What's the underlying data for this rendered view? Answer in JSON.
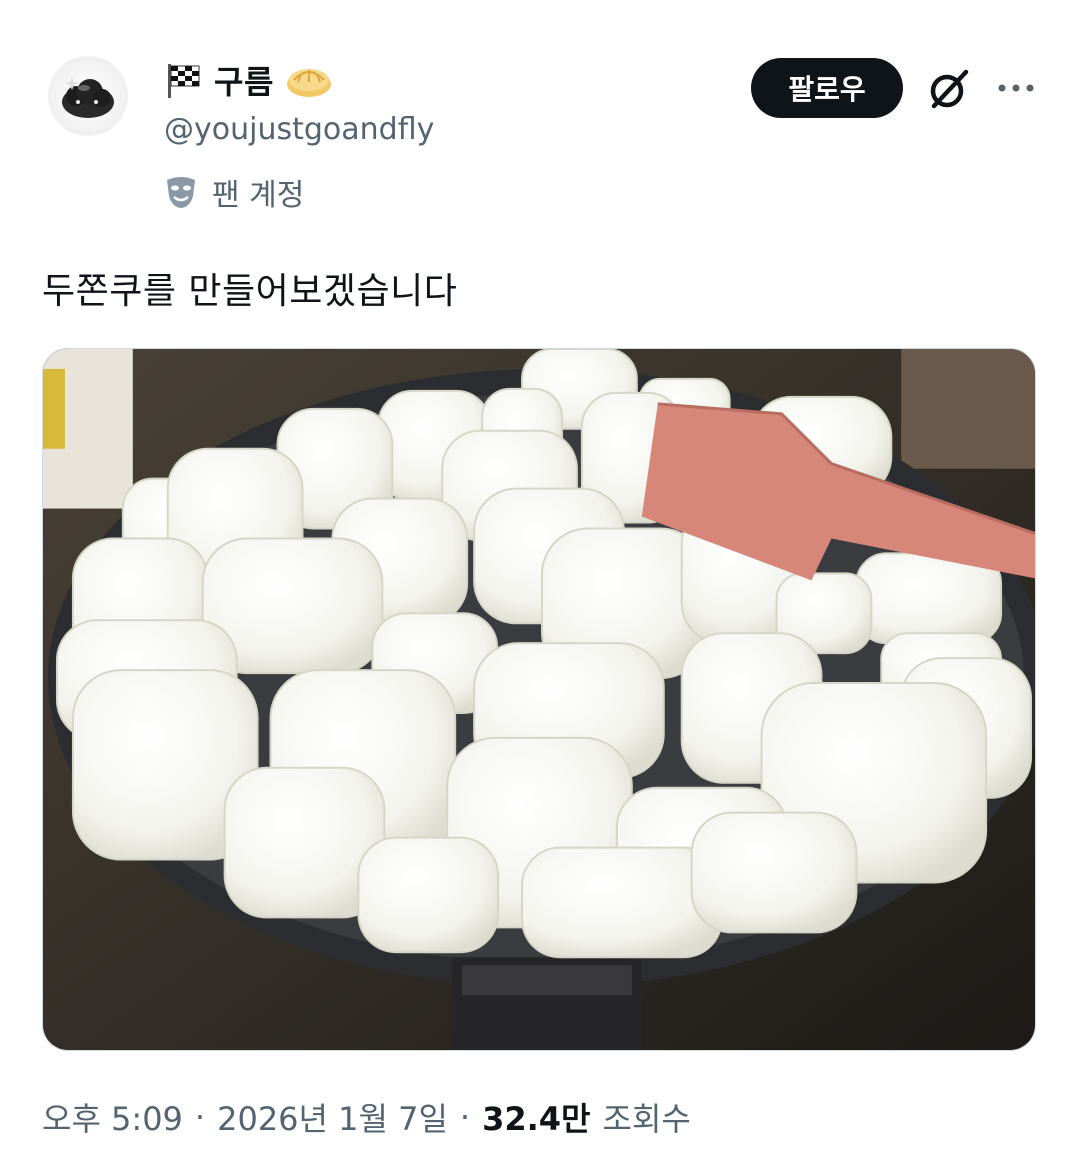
{
  "author": {
    "display_name": "구름",
    "handle": "@youjustgoandfly",
    "account_label": "팬 계정",
    "name_icon_left": "checkered-flag-icon",
    "name_icon_right": "bread-icon",
    "label_icon": "theater-mask-icon"
  },
  "actions": {
    "follow_label": "팔로우",
    "grok_icon": "grok-icon",
    "more_icon": "more-icon"
  },
  "post": {
    "text": "두쫀쿠를 만들어보겠습니다",
    "media_icon": "marshmallow-pan-photo"
  },
  "meta": {
    "time": "오후 5:09",
    "separator": "·",
    "date": "2026년 1월 7일",
    "views_count": "32.4만",
    "views_label": "조회수"
  },
  "colors": {
    "text_primary": "#0f1419",
    "text_secondary": "#536471",
    "follow_bg": "#0f1419",
    "border": "#cfd9de"
  }
}
